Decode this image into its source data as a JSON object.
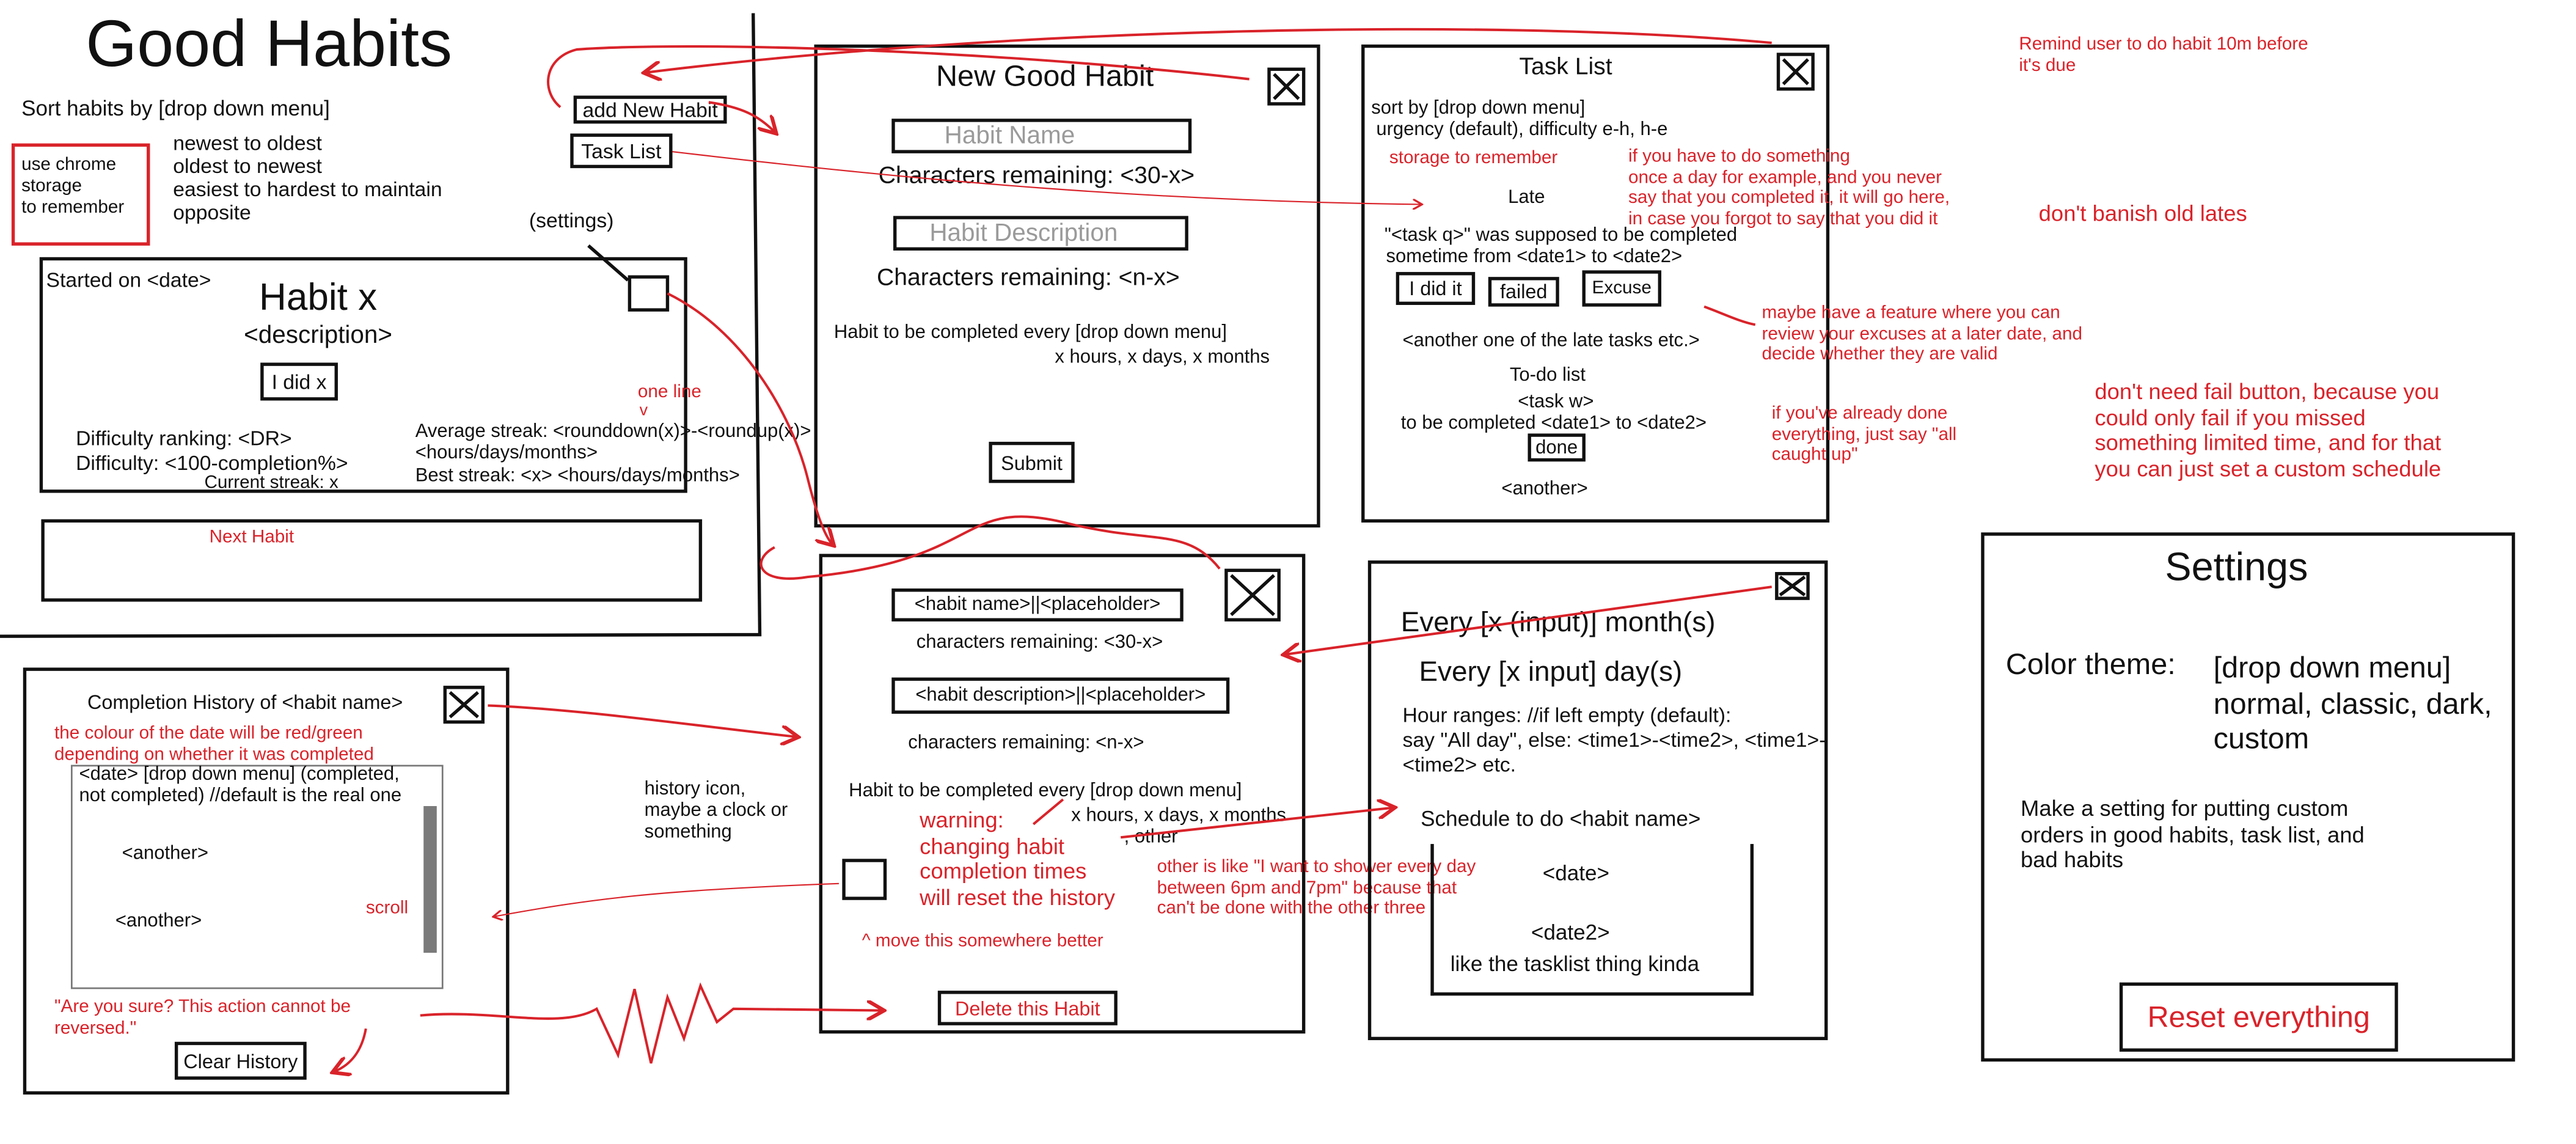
{
  "colors": {
    "ink": "#111111",
    "annotation": "#d9232a",
    "scrollbar": "#7a7a7a",
    "placeholder": "#9a9a9a"
  },
  "main": {
    "title": "Good Habits",
    "sort_label": "Sort habits by [drop down menu]",
    "storage_note": "use chrome\nstorage\nto remember",
    "sort_options": [
      "newest to oldest",
      "oldest to newest",
      "easiest to hardest to maintain",
      "opposite"
    ],
    "add_button": "add New Habit",
    "task_button": "Task List",
    "settings_label": "(settings)",
    "habit_card": {
      "started": "Started on <date>",
      "title": "Habit x",
      "description": "<description>",
      "did_button": "I did x",
      "difficulty_ranking": "Difficulty ranking: <DR>",
      "difficulty": "Difficulty: <100-completion%>",
      "current_streak": "Current streak: x",
      "average_streak_1": "Average streak: <rounddown(x)>-<roundup(x)>",
      "average_streak_2": "<hours/days/months>",
      "best_streak": "Best streak: <x> <hours/days/months>",
      "one_line": "one line",
      "one_line_arrow": "v"
    },
    "next_habit": "Next Habit"
  },
  "new_habit": {
    "title": "New Good Habit",
    "name_placeholder": "Habit Name",
    "name_remaining": "Characters remaining: <30-x>",
    "desc_placeholder": "Habit Description",
    "desc_remaining": "Characters remaining: <n-x>",
    "schedule_1": "Habit to be completed every [drop down menu]",
    "schedule_2": "x hours, x days, x months",
    "submit": "Submit"
  },
  "task_list": {
    "title": "Task List",
    "sort_1": "sort by [drop down menu]",
    "sort_2": "urgency (default), difficulty e-h, h-e",
    "storage_note": "storage to remember",
    "late_heading": "Late",
    "late_task_1": "\"<task q>\" was supposed to be completed",
    "late_task_2": "sometime from <date1> to <date2>",
    "did_button": "I did it",
    "failed_button": "failed",
    "excuse_button": "Excuse",
    "another_late": "<another one of the late tasks etc.>",
    "todo_heading": "To-do list",
    "todo_task_1": "<task w>",
    "todo_task_2": "to be completed <date1> to <date2>",
    "done_button": "done",
    "another": "<another>",
    "note_once_a_day": "if you have to do something\nonce a day for example, and you never\nsay that you completed it, it will go here,\nin case you forgot to say that you did it",
    "note_excuses": "maybe have a feature where you can\nreview your excuses at a later date, and\ndecide whether they are valid",
    "note_caught_up": "if you've already done\neverything, just say \"all\ncaught up\""
  },
  "notes": {
    "remind": "Remind user to do habit 10m before\nit's due",
    "dont_banish": "don't banish old lates",
    "no_fail": "don't need fail button, because you\ncould only fail if you missed\nsomething limited time, and for that\nyou can just set a custom schedule"
  },
  "history": {
    "title": "Completion History of <habit name>",
    "note_colour": "the colour of the date will be red/green\ndepending on whether it was completed",
    "entry": "<date> [drop down menu] (completed,\nnot completed) //default is the real one",
    "another_1": "<another>",
    "another_2": "<another>",
    "scroll": "scroll",
    "are_you_sure": "\"Are you sure? This action cannot be\nreversed.\"",
    "clear_button": "Clear History",
    "history_icon_note": "history icon,\nmaybe a clock or\nsomething"
  },
  "edit_habit": {
    "name_field": "<habit name>||<placeholder>",
    "name_remaining": "characters remaining: <30-x>",
    "desc_field": "<habit description>||<placeholder>",
    "desc_remaining": "characters remaining: <n-x>",
    "schedule": "Habit to be completed every [drop down menu]",
    "options": "x hours, x days, x months",
    "other": ", other",
    "warning": "warning:\nchanging habit\ncompletion times\nwill reset the history",
    "move_note": "^ move this somewhere better",
    "other_note": "other is like \"I want to shower every day\nbetween 6pm and 7pm\" because that\ncan't be done with the other three",
    "delete_button": "Delete this Habit"
  },
  "custom_schedule": {
    "every_month": "Every [x (input)] month(s)",
    "every_day": "Every [x input] day(s)",
    "hour_ranges": "Hour ranges: //if left empty (default):\nsay \"All day\", else: <time1>-<time2>, <time1>-\n<time2> etc.",
    "schedule_heading": "Schedule to do <habit name>",
    "date": "<date>",
    "date2": "<date2>",
    "tasklist_note": "like the tasklist thing kinda"
  },
  "settings": {
    "title": "Settings",
    "color_theme_label": "Color theme:",
    "color_theme_value": "[drop down menu]\nnormal, classic, dark,\ncustom",
    "custom_order": "Make a setting for putting custom\norders in good habits, task list, and\nbad habits",
    "reset_button": "Reset everything"
  }
}
